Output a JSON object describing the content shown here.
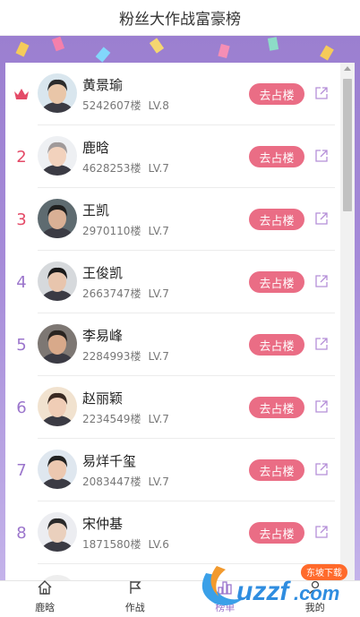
{
  "header": {
    "title": "粉丝大作战富豪榜"
  },
  "actions": {
    "occupy_label": "去占楼"
  },
  "ranking": [
    {
      "rank": "",
      "crown": true,
      "name": "黄景瑜",
      "floors": "5242607楼",
      "level": "LV.8",
      "avatar_skin": "#e9c6a8",
      "avatar_hair": "#2b2b2b",
      "avatar_bg": "#d9e6ee",
      "rank_color": "red"
    },
    {
      "rank": "2",
      "crown": false,
      "name": "鹿晗",
      "floors": "4628253楼",
      "level": "LV.7",
      "avatar_skin": "#f2d2bd",
      "avatar_hair": "#a09a9a",
      "avatar_bg": "#eef0f3",
      "rank_color": "red"
    },
    {
      "rank": "3",
      "crown": false,
      "name": "王凯",
      "floors": "2970110楼",
      "level": "LV.7",
      "avatar_skin": "#d9b095",
      "avatar_hair": "#1f1f1f",
      "avatar_bg": "#5e6b70",
      "rank_color": "red"
    },
    {
      "rank": "4",
      "crown": false,
      "name": "王俊凯",
      "floors": "2663747楼",
      "level": "LV.7",
      "avatar_skin": "#e8c5ad",
      "avatar_hair": "#1a1a1a",
      "avatar_bg": "#d6d9dc",
      "rank_color": "purple"
    },
    {
      "rank": "5",
      "crown": false,
      "name": "李易峰",
      "floors": "2284993楼",
      "level": "LV.7",
      "avatar_skin": "#d8a98a",
      "avatar_hair": "#2a2420",
      "avatar_bg": "#7d7773",
      "rank_color": "purple"
    },
    {
      "rank": "6",
      "crown": false,
      "name": "赵丽颖",
      "floors": "2234549楼",
      "level": "LV.7",
      "avatar_skin": "#f0cdb6",
      "avatar_hair": "#3a2a22",
      "avatar_bg": "#f1e2cf",
      "rank_color": "purple"
    },
    {
      "rank": "7",
      "crown": false,
      "name": "易烊千玺",
      "floors": "2083447楼",
      "level": "LV.7",
      "avatar_skin": "#ecc8b0",
      "avatar_hair": "#222222",
      "avatar_bg": "#dfe7ef",
      "rank_color": "purple"
    },
    {
      "rank": "8",
      "crown": false,
      "name": "宋仲基",
      "floors": "1871580楼",
      "level": "LV.6",
      "avatar_skin": "#ead0bd",
      "avatar_hair": "#2a2a2a",
      "avatar_bg": "#ecedf1",
      "rank_color": "purple"
    },
    {
      "rank": "",
      "crown": false,
      "name": "",
      "floors": "",
      "level": "",
      "avatar_skin": "#ddd",
      "avatar_hair": "#222",
      "avatar_bg": "#eee",
      "rank_color": "purple"
    }
  ],
  "tabbar": {
    "items": [
      {
        "label": "鹿晗",
        "icon": "home-icon",
        "active": false
      },
      {
        "label": "作战",
        "icon": "flag-icon",
        "active": false
      },
      {
        "label": "榜单",
        "icon": "rank-icon",
        "active": true
      },
      {
        "label": "我的",
        "icon": "user-icon",
        "active": false
      }
    ]
  },
  "watermark": {
    "brand": "uzzf.com",
    "tag": "东坡下载"
  },
  "colors": {
    "accent": "#9b75cc",
    "occupy": "#ea6d85",
    "rank_red": "#e44a67",
    "banner": "#a58ad8"
  }
}
